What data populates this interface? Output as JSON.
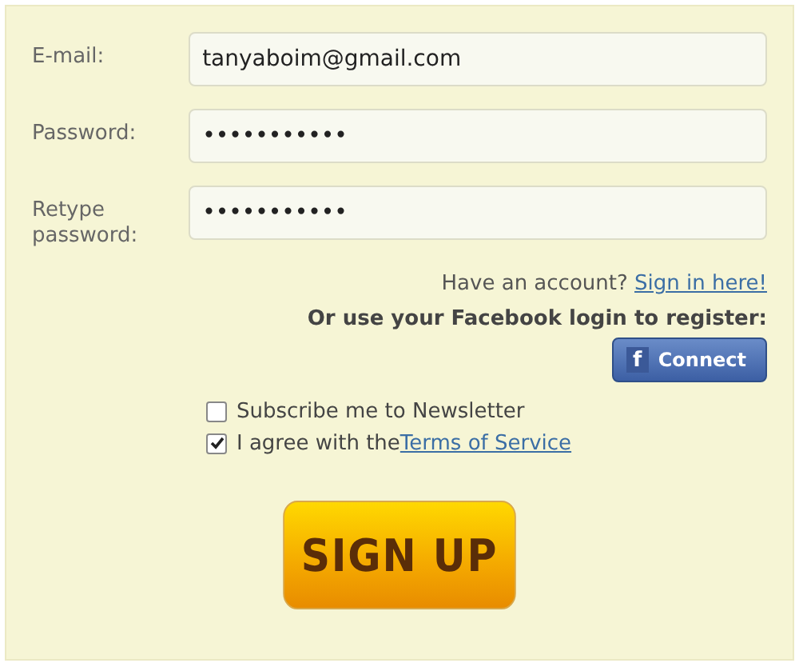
{
  "fields": [
    {
      "label": "E-mail:",
      "value": "tanyaboim@gmail.com"
    },
    {
      "label": "Password:",
      "value": "•••••••••••"
    },
    {
      "label": "Retype password:",
      "value": "•••••••••••"
    }
  ],
  "signin": {
    "text": "Have an account?",
    "link": "Sign in here!"
  },
  "facebook": {
    "prompt": "Or use your Facebook login to register:",
    "icon": "f",
    "label": "Connect"
  },
  "options": [
    {
      "text": "Subscribe me to Newsletter",
      "checked": false
    },
    {
      "text": "I agree with the",
      "link": "Terms of Service",
      "checked": true
    }
  ],
  "submit": "SIGN UP"
}
